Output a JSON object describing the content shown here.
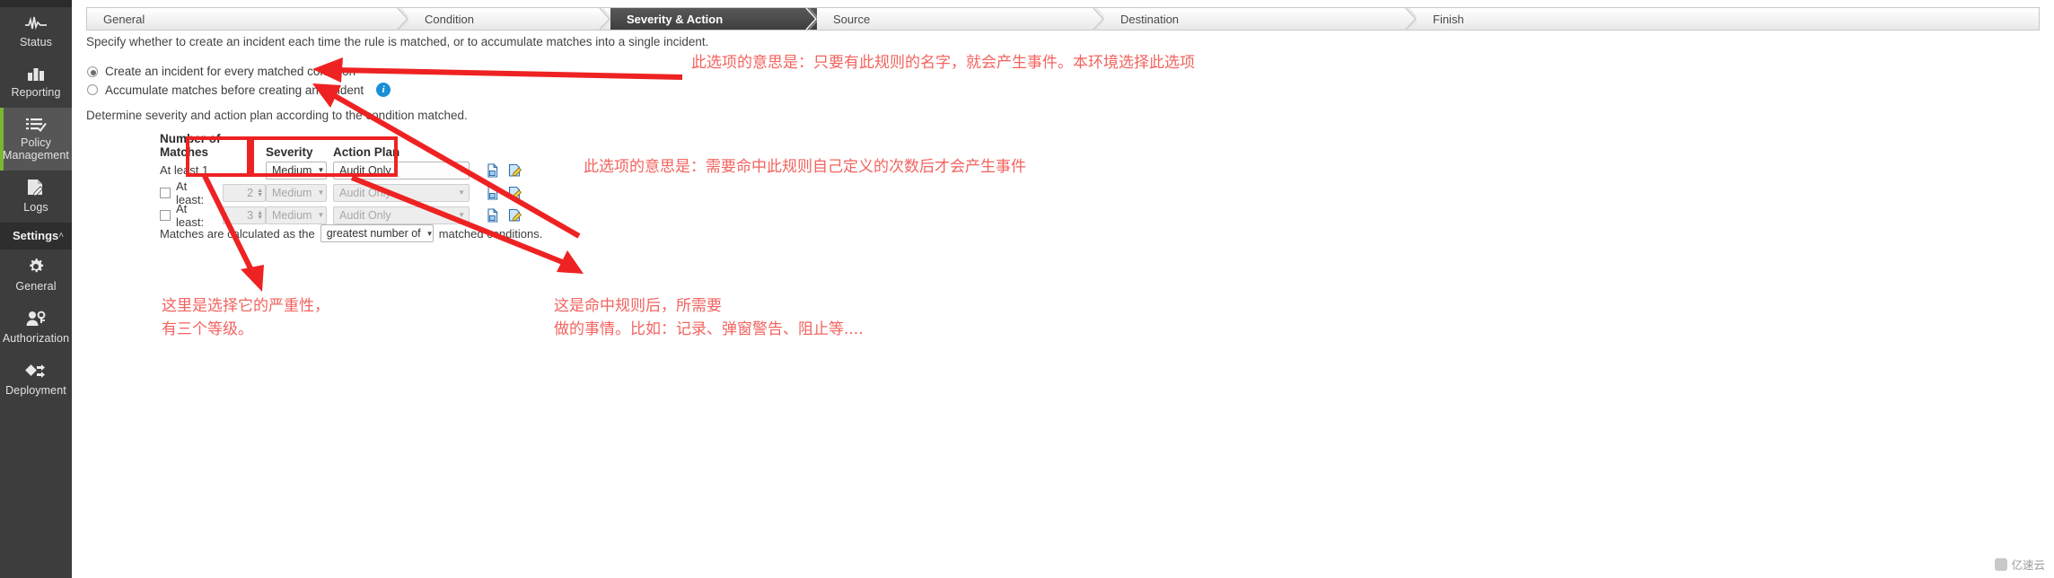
{
  "sidebar": {
    "items": [
      {
        "label": "Status",
        "icon": "pulse-icon",
        "active": false
      },
      {
        "label": "Reporting",
        "icon": "bar-chart-icon",
        "active": false
      },
      {
        "label": "Policy Management",
        "icon": "checklist-icon",
        "active": true
      },
      {
        "label": "Logs",
        "icon": "document-edit-icon",
        "active": false
      }
    ],
    "section": {
      "label": "Settings",
      "caret": "˄"
    },
    "sub_items": [
      {
        "label": "General",
        "icon": "gear-icon"
      },
      {
        "label": "Authorization",
        "icon": "user-key-icon"
      },
      {
        "label": "Deployment",
        "icon": "deployment-icon"
      }
    ]
  },
  "wizard": {
    "steps": [
      {
        "label": "General",
        "current": false
      },
      {
        "label": "Condition",
        "current": false
      },
      {
        "label": "Severity & Action",
        "current": true
      },
      {
        "label": "Source",
        "current": false
      },
      {
        "label": "Destination",
        "current": false
      },
      {
        "label": "Finish",
        "current": false
      }
    ]
  },
  "main": {
    "intro_text": "Specify whether to create an incident each time the rule is matched, or to accumulate matches into a single incident.",
    "options": [
      {
        "label": "Create an incident for every matched condition",
        "checked": true,
        "info": false
      },
      {
        "label": "Accumulate matches before creating an incident",
        "checked": false,
        "info": true,
        "info_glyph": "i"
      }
    ],
    "determine_text": "Determine severity and action plan according to the condition matched.",
    "table": {
      "headers": [
        "Number of Matches",
        "Severity",
        "Action Plan"
      ],
      "rows": [
        {
          "checkbox": false,
          "has_checkbox": false,
          "match_label": "At least 1",
          "count": "",
          "severity": "Medium",
          "action_plan": "Audit Only",
          "disabled": false,
          "icons": [
            "copy-icon",
            "edit-icon"
          ]
        },
        {
          "checkbox": false,
          "has_checkbox": true,
          "match_label": "At least:",
          "count": "2",
          "severity": "Medium",
          "action_plan": "Audit Only",
          "disabled": true,
          "icons": [
            "copy-icon",
            "edit-icon"
          ]
        },
        {
          "checkbox": false,
          "has_checkbox": true,
          "match_label": "At least:",
          "count": "3",
          "severity": "Medium",
          "action_plan": "Audit Only",
          "disabled": true,
          "icons": [
            "copy-icon",
            "edit-icon"
          ]
        }
      ]
    },
    "calc_row": {
      "prefix": "Matches are calculated as the",
      "select_value": "greatest number of",
      "suffix": "matched conditions."
    }
  },
  "annotations": {
    "note_top": "此选项的意思是：只要有此规则的名字，就会产生事件。本环境选择此选项",
    "note_mid": "此选项的意思是：需要命中此规则自己定义的次数后才会产生事件",
    "note_sev_l1": "这里是选择它的严重性，",
    "note_sev_l2": "有三个等级。",
    "note_act_l1": "这是命中规则后，所需要",
    "note_act_l2": "做的事情。比如：记录、弹窗警告、阻止等....",
    "accent_red": "#ee2222",
    "text_red": "#f2635f"
  },
  "watermark": {
    "text": "亿速云"
  }
}
